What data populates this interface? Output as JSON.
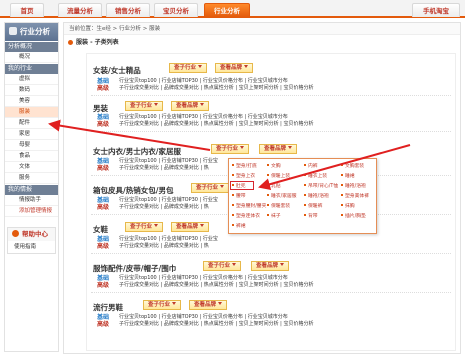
{
  "nav": {
    "tabs": [
      {
        "label": "首页"
      },
      {
        "label": "流量分析"
      },
      {
        "label": "销售分析"
      },
      {
        "label": "宝贝分析"
      },
      {
        "label": "行业分析"
      }
    ],
    "mobile": "手机淘宝"
  },
  "sidebar": {
    "title": "行业分析",
    "sections": [
      {
        "title": "分析概况",
        "items": [
          "概况"
        ]
      },
      {
        "title": "我的行业",
        "items": [
          "虚拟",
          "数码",
          "美容",
          "服装",
          "配件",
          "家居",
          "母婴",
          "食品",
          "文体",
          "服务"
        ]
      },
      {
        "title": "我的情报",
        "items": [
          "情报助手",
          "添加管理情报"
        ]
      }
    ],
    "help": {
      "title": "帮助中心",
      "link": "使用指南"
    }
  },
  "breadcrumb": "当前位置：生e经 > 行业分析 > 服装",
  "section_title": "服装 - 子类列表",
  "categories": [
    {
      "title": "女装/女士精品",
      "btn1": "查子行业",
      "btn2": "查看品牌",
      "tag1": "基础",
      "tag2": "高级",
      "line1": "行业宝贝top100 | 行业店铺TOP30 | 行业宝贝价格分布 | 行业宝贝城市分布",
      "line2": "子行业成交量对比 | 品牌成交量对比 | 热点属性分析 | 宝贝上架时间分析 | 宝贝价格分析"
    },
    {
      "title": "男装",
      "btn1": "查子行业",
      "btn2": "查看品牌",
      "tag1": "基础",
      "tag2": "高级",
      "line1": "行业宝贝top100 | 行业店铺TOP30 | 行业宝贝价格分布 | 行业宝贝城市分布",
      "line2": "子行业成交量对比 | 品牌成交量对比 | 热点属性分析 | 宝贝上架时间分析 | 宝贝价格分析"
    },
    {
      "title": "女士内衣/男士内衣/家居服",
      "btn1": "查子行业",
      "btn2": "查看品牌",
      "tag1": "基础",
      "tag2": "高级",
      "line1": "行业宝贝top100 | 行业店铺TOP30 | 行业宝",
      "line2": "子行业成交量对比 | 品牌成交量对比 | 热"
    },
    {
      "title": "箱包皮具/热销女包/男包",
      "btn1": "查子行业",
      "btn2": "",
      "tag1": "基础",
      "tag2": "高级",
      "line1": "行业宝贝top100 | 行业店铺TOP30 | 行业宝",
      "line2": "子行业成交量对比 | 品牌成交量对比 | 热"
    },
    {
      "title": "女鞋",
      "btn1": "查子行业",
      "btn2": "查看品牌",
      "tag1": "基础",
      "tag2": "高级",
      "line1": "行业宝贝top100 | 行业店铺TOP30 | 行业宝",
      "line2": "子行业成交量对比 | 品牌成交量对比 | 热"
    },
    {
      "title": "服饰配件/皮带/帽子/围巾",
      "btn1": "查子行业",
      "btn2": "查看品牌",
      "tag1": "基础",
      "tag2": "高级",
      "line1": "行业宝贝top100 | 行业店铺TOP30 | 行业宝贝价格分布 | 行业宝贝城市分布",
      "line2": "子行业成交量对比 | 品牌成交量对比 | 热点属性分析 | 宝贝上架时间分析 | 宝贝价格分析"
    },
    {
      "title": "流行男鞋",
      "btn1": "查子行业",
      "btn2": "查看品牌",
      "tag1": "基础",
      "tag2": "高级",
      "line1": "行业宝贝top100 | 行业店铺TOP30 | 行业宝贝价格分布 | 行业宝贝城市分布",
      "line2": "子行业成交量对比 | 品牌成交量对比 | 热点属性分析 | 宝贝上架时间分析 | 宝贝价格分析"
    }
  ],
  "dropdown": {
    "items": [
      [
        "塑身/打底",
        "文胸",
        "内裤",
        "文胸套装"
      ],
      [
        "塑身上衣",
        "保暖上装",
        "睡衣上装",
        "睡裙"
      ],
      [
        "肚兜",
        "乳贴",
        "吊带/背心/T恤",
        "睡袍/浴袍"
      ],
      [
        "腰带",
        "睡衣/家居服",
        "睡袍/浴袍",
        "塑身美体裤"
      ],
      [
        "塑身腰封/腰夹",
        "保暖套装",
        "保暖裤",
        "抹胸"
      ],
      [
        "塑身连体衣",
        "袜子",
        "背带",
        "插片/胸垫"
      ],
      [
        "裤裙",
        "",
        "",
        ""
      ]
    ]
  }
}
